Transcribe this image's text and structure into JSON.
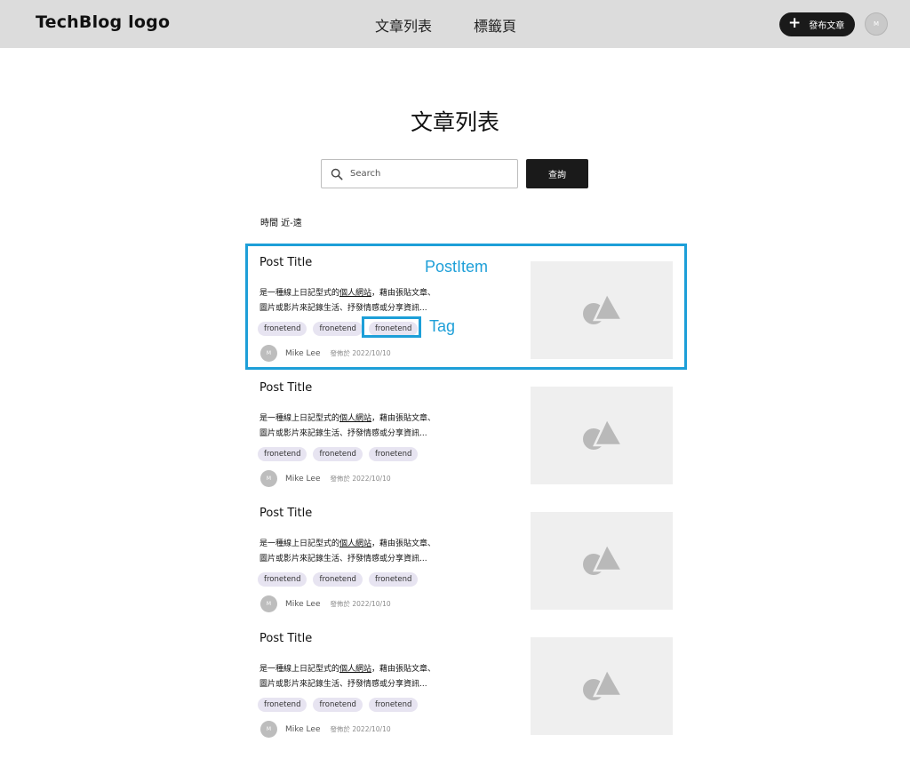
{
  "header": {
    "logo": "TechBlog logo",
    "nav": [
      "文章列表",
      "標籤頁"
    ],
    "publish_label": "發布文章",
    "avatar_initial": "M"
  },
  "page": {
    "title": "文章列表",
    "search_placeholder": "Search",
    "search_button": "查詢",
    "sort_label": "時間 近-遠"
  },
  "posts": [
    {
      "title": "Post Title",
      "excerpt_line1_pre": "是一種線上日記型式的",
      "excerpt_link": "個人網站",
      "excerpt_line1_post": "，藉由張貼文章、",
      "excerpt_line2": "圖片或影片來記錄生活、抒發情感或分享資訊...",
      "tags": [
        "fronetend",
        "fronetend",
        "fronetend"
      ],
      "author_initial": "M",
      "author": "Mike Lee",
      "date": "發佈於 2022/10/10"
    },
    {
      "title": "Post Title",
      "excerpt_line1_pre": "是一種線上日記型式的",
      "excerpt_link": "個人網站",
      "excerpt_line1_post": "，藉由張貼文章、",
      "excerpt_line2": "圖片或影片來記錄生活、抒發情感或分享資訊...",
      "tags": [
        "fronetend",
        "fronetend",
        "fronetend"
      ],
      "author_initial": "M",
      "author": "Mike Lee",
      "date": "發佈於 2022/10/10"
    },
    {
      "title": "Post Title",
      "excerpt_line1_pre": "是一種線上日記型式的",
      "excerpt_link": "個人網站",
      "excerpt_line1_post": "，藉由張貼文章、",
      "excerpt_line2": "圖片或影片來記錄生活、抒發情感或分享資訊...",
      "tags": [
        "fronetend",
        "fronetend",
        "fronetend"
      ],
      "author_initial": "M",
      "author": "Mike Lee",
      "date": "發佈於 2022/10/10"
    },
    {
      "title": "Post Title",
      "excerpt_line1_pre": "是一種線上日記型式的",
      "excerpt_link": "個人網站",
      "excerpt_line1_post": "，藉由張貼文章、",
      "excerpt_line2": "圖片或影片來記錄生活、抒發情感或分享資訊...",
      "tags": [
        "fronetend",
        "fronetend",
        "fronetend"
      ],
      "author_initial": "M",
      "author": "Mike Lee",
      "date": "發佈於 2022/10/10"
    }
  ],
  "annotations": {
    "post_item": "PostItem",
    "tag": "Tag"
  },
  "colors": {
    "header_bg": "#dcdcdc",
    "primary_button": "#1a1a1a",
    "tag_bg": "#e7e4f1",
    "annotation": "#1d9fd8",
    "thumbnail_bg": "#efefef"
  },
  "icons": {
    "search": "search-icon",
    "plus": "plus-icon",
    "thumbnail": "image-placeholder-icon"
  }
}
